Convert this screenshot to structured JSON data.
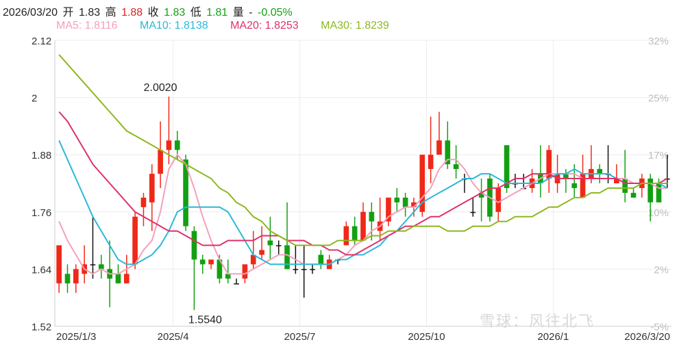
{
  "header": {
    "date": "2026/03/20",
    "open_label": "开",
    "open": "1.83",
    "high_label": "高",
    "high": "1.88",
    "close_label": "收",
    "close": "1.83",
    "low_label": "低",
    "low": "1.81",
    "volume_label": "量",
    "volume": "-",
    "change": "-0.05%"
  },
  "ma_legend": [
    {
      "text": "MA5: 1.8116",
      "color": "#f4a0b8"
    },
    {
      "text": "MA10: 1.8138",
      "color": "#2ab8d8"
    },
    {
      "text": "MA20: 1.8253",
      "color": "#e0306a"
    },
    {
      "text": "MA30: 1.8239",
      "color": "#8cb820"
    }
  ],
  "watermark": "雪球：风往北飞",
  "chart_data": {
    "type": "candlestick",
    "y_ticks": [
      "2.12",
      "2",
      "1.88",
      "1.76",
      "1.64",
      "1.52"
    ],
    "y_values": [
      2.12,
      2.0,
      1.88,
      1.76,
      1.64,
      1.52
    ],
    "ylim": [
      1.52,
      2.12
    ],
    "right_ticks": [
      "32%",
      "25%",
      "17%",
      "10%",
      "2%",
      "-5%"
    ],
    "x_ticks": [
      "2025/1/3",
      "2025/4",
      "2025/7",
      "2025/10",
      "2026/1",
      "2026/3/20"
    ],
    "x_tick_index": [
      0,
      13.5,
      28.5,
      43.5,
      58.5,
      71.5
    ],
    "n_candles": 73,
    "max_label": "2.0020",
    "max_index": 12,
    "min_label": "1.5540",
    "min_index": 16,
    "candles": [
      [
        1.61,
        1.69,
        1.59,
        1.67
      ],
      [
        1.63,
        1.61,
        1.59,
        1.65
      ],
      [
        1.61,
        1.64,
        1.59,
        1.65
      ],
      [
        1.63,
        1.65,
        1.61,
        1.69
      ],
      [
        1.65,
        1.65,
        1.62,
        1.75
      ],
      [
        1.65,
        1.64,
        1.62,
        1.67
      ],
      [
        1.64,
        1.62,
        1.56,
        1.7
      ],
      [
        1.63,
        1.61,
        1.61,
        1.65
      ],
      [
        1.61,
        1.63,
        1.61,
        1.67
      ],
      [
        1.65,
        1.75,
        1.64,
        1.76
      ],
      [
        1.77,
        1.79,
        1.73,
        1.8
      ],
      [
        1.78,
        1.84,
        1.72,
        1.86
      ],
      [
        1.84,
        1.89,
        1.81,
        1.95
      ],
      [
        1.89,
        1.91,
        1.86,
        2.002
      ],
      [
        1.91,
        1.89,
        1.87,
        1.93
      ],
      [
        1.87,
        1.73,
        1.72,
        1.88
      ],
      [
        1.72,
        1.66,
        1.554,
        1.73
      ],
      [
        1.66,
        1.65,
        1.63,
        1.67
      ],
      [
        1.65,
        1.66,
        1.64,
        1.66
      ],
      [
        1.66,
        1.62,
        1.61,
        1.67
      ],
      [
        1.63,
        1.62,
        1.61,
        1.66
      ],
      [
        1.61,
        1.61,
        1.61,
        1.62
      ],
      [
        1.62,
        1.65,
        1.61,
        1.65
      ],
      [
        1.65,
        1.67,
        1.64,
        1.72
      ],
      [
        1.67,
        1.68,
        1.66,
        1.73
      ],
      [
        1.7,
        1.69,
        1.66,
        1.75
      ],
      [
        1.69,
        1.69,
        1.67,
        1.7
      ],
      [
        1.69,
        1.64,
        1.64,
        1.78
      ],
      [
        1.64,
        1.64,
        1.63,
        1.69
      ],
      [
        1.64,
        1.64,
        1.58,
        1.69
      ],
      [
        1.64,
        1.64,
        1.63,
        1.65
      ],
      [
        1.67,
        1.65,
        1.64,
        1.68
      ],
      [
        1.64,
        1.66,
        1.64,
        1.67
      ],
      [
        1.66,
        1.66,
        1.65,
        1.66
      ],
      [
        1.69,
        1.73,
        1.69,
        1.74
      ],
      [
        1.73,
        1.7,
        1.69,
        1.75
      ],
      [
        1.7,
        1.76,
        1.7,
        1.78
      ],
      [
        1.76,
        1.74,
        1.7,
        1.78
      ],
      [
        1.72,
        1.74,
        1.7,
        1.79
      ],
      [
        1.74,
        1.79,
        1.73,
        1.79
      ],
      [
        1.79,
        1.78,
        1.76,
        1.81
      ],
      [
        1.79,
        1.77,
        1.75,
        1.8
      ],
      [
        1.77,
        1.78,
        1.75,
        1.79
      ],
      [
        1.76,
        1.88,
        1.75,
        1.88
      ],
      [
        1.85,
        1.88,
        1.82,
        1.96
      ],
      [
        1.88,
        1.91,
        1.88,
        1.97
      ],
      [
        1.91,
        1.86,
        1.85,
        1.95
      ],
      [
        1.86,
        1.85,
        1.83,
        1.9
      ],
      [
        1.83,
        1.83,
        1.8,
        1.84
      ],
      [
        1.76,
        1.76,
        1.75,
        1.79
      ],
      [
        1.8,
        1.79,
        1.74,
        1.83
      ],
      [
        1.83,
        1.75,
        1.74,
        1.84
      ],
      [
        1.76,
        1.81,
        1.74,
        1.82
      ],
      [
        1.9,
        1.81,
        1.8,
        1.9
      ],
      [
        1.82,
        1.82,
        1.81,
        1.84
      ],
      [
        1.81,
        1.81,
        1.81,
        1.84
      ],
      [
        1.81,
        1.83,
        1.8,
        1.85
      ],
      [
        1.84,
        1.82,
        1.79,
        1.9
      ],
      [
        1.83,
        1.89,
        1.8,
        1.9
      ],
      [
        1.82,
        1.84,
        1.8,
        1.88
      ],
      [
        1.84,
        1.83,
        1.8,
        1.85
      ],
      [
        1.82,
        1.81,
        1.79,
        1.86
      ],
      [
        1.79,
        1.84,
        1.79,
        1.88
      ],
      [
        1.83,
        1.85,
        1.82,
        1.9
      ],
      [
        1.85,
        1.84,
        1.82,
        1.86
      ],
      [
        1.84,
        1.84,
        1.82,
        1.9
      ],
      [
        1.82,
        1.83,
        1.82,
        1.86
      ],
      [
        1.83,
        1.8,
        1.78,
        1.89
      ],
      [
        1.8,
        1.79,
        1.79,
        1.81
      ],
      [
        1.81,
        1.83,
        1.79,
        1.84
      ],
      [
        1.83,
        1.78,
        1.74,
        1.84
      ],
      [
        1.82,
        1.78,
        1.78,
        1.83
      ],
      [
        1.83,
        1.83,
        1.81,
        1.88
      ]
    ],
    "ma_lines": [
      {
        "name": "MA5",
        "color": "#f4a0b8",
        "values": [
          1.74,
          1.7,
          1.67,
          1.64,
          1.63,
          1.64,
          1.63,
          1.63,
          1.64,
          1.65,
          1.68,
          1.7,
          1.76,
          1.85,
          1.88,
          1.86,
          1.81,
          1.75,
          1.7,
          1.66,
          1.63,
          1.63,
          1.63,
          1.64,
          1.65,
          1.66,
          1.67,
          1.67,
          1.66,
          1.65,
          1.65,
          1.65,
          1.65,
          1.66,
          1.67,
          1.69,
          1.7,
          1.72,
          1.73,
          1.75,
          1.76,
          1.77,
          1.77,
          1.79,
          1.81,
          1.85,
          1.87,
          1.87,
          1.85,
          1.82,
          1.8,
          1.79,
          1.78,
          1.79,
          1.8,
          1.81,
          1.82,
          1.83,
          1.84,
          1.84,
          1.84,
          1.84,
          1.83,
          1.83,
          1.83,
          1.83,
          1.83,
          1.83,
          1.82,
          1.82,
          1.82,
          1.81,
          1.81
        ]
      },
      {
        "name": "MA10",
        "color": "#2ab8d8",
        "values": [
          1.91,
          1.87,
          1.83,
          1.79,
          1.75,
          1.72,
          1.69,
          1.66,
          1.65,
          1.65,
          1.66,
          1.67,
          1.69,
          1.72,
          1.76,
          1.77,
          1.77,
          1.77,
          1.77,
          1.77,
          1.76,
          1.73,
          1.7,
          1.67,
          1.66,
          1.65,
          1.65,
          1.65,
          1.65,
          1.65,
          1.65,
          1.65,
          1.65,
          1.66,
          1.66,
          1.67,
          1.67,
          1.68,
          1.69,
          1.71,
          1.72,
          1.74,
          1.76,
          1.78,
          1.79,
          1.8,
          1.81,
          1.82,
          1.83,
          1.83,
          1.84,
          1.84,
          1.83,
          1.82,
          1.82,
          1.82,
          1.82,
          1.82,
          1.83,
          1.84,
          1.84,
          1.85,
          1.84,
          1.84,
          1.84,
          1.84,
          1.83,
          1.82,
          1.82,
          1.82,
          1.82,
          1.82,
          1.81
        ]
      },
      {
        "name": "MA20",
        "color": "#e0306a",
        "values": [
          1.97,
          1.95,
          1.92,
          1.89,
          1.86,
          1.84,
          1.82,
          1.8,
          1.78,
          1.76,
          1.75,
          1.74,
          1.73,
          1.72,
          1.72,
          1.71,
          1.7,
          1.69,
          1.69,
          1.69,
          1.7,
          1.7,
          1.7,
          1.7,
          1.71,
          1.71,
          1.71,
          1.7,
          1.7,
          1.7,
          1.69,
          1.69,
          1.68,
          1.68,
          1.67,
          1.67,
          1.68,
          1.69,
          1.7,
          1.71,
          1.72,
          1.73,
          1.73,
          1.74,
          1.75,
          1.75,
          1.76,
          1.77,
          1.78,
          1.79,
          1.8,
          1.81,
          1.81,
          1.82,
          1.83,
          1.83,
          1.84,
          1.84,
          1.84,
          1.83,
          1.83,
          1.83,
          1.83,
          1.83,
          1.83,
          1.83,
          1.83,
          1.82,
          1.82,
          1.82,
          1.82,
          1.82,
          1.83
        ]
      },
      {
        "name": "MA30",
        "color": "#8cb820",
        "values": [
          2.09,
          2.07,
          2.05,
          2.03,
          2.01,
          1.99,
          1.97,
          1.95,
          1.93,
          1.92,
          1.91,
          1.9,
          1.89,
          1.88,
          1.87,
          1.86,
          1.85,
          1.84,
          1.83,
          1.81,
          1.8,
          1.78,
          1.77,
          1.75,
          1.74,
          1.72,
          1.71,
          1.7,
          1.69,
          1.69,
          1.69,
          1.69,
          1.69,
          1.7,
          1.7,
          1.7,
          1.7,
          1.71,
          1.71,
          1.72,
          1.72,
          1.72,
          1.73,
          1.73,
          1.73,
          1.73,
          1.72,
          1.72,
          1.72,
          1.73,
          1.73,
          1.73,
          1.74,
          1.74,
          1.75,
          1.75,
          1.75,
          1.76,
          1.77,
          1.77,
          1.78,
          1.79,
          1.79,
          1.8,
          1.8,
          1.81,
          1.81,
          1.81,
          1.81,
          1.82,
          1.82,
          1.82,
          1.82
        ]
      }
    ]
  }
}
